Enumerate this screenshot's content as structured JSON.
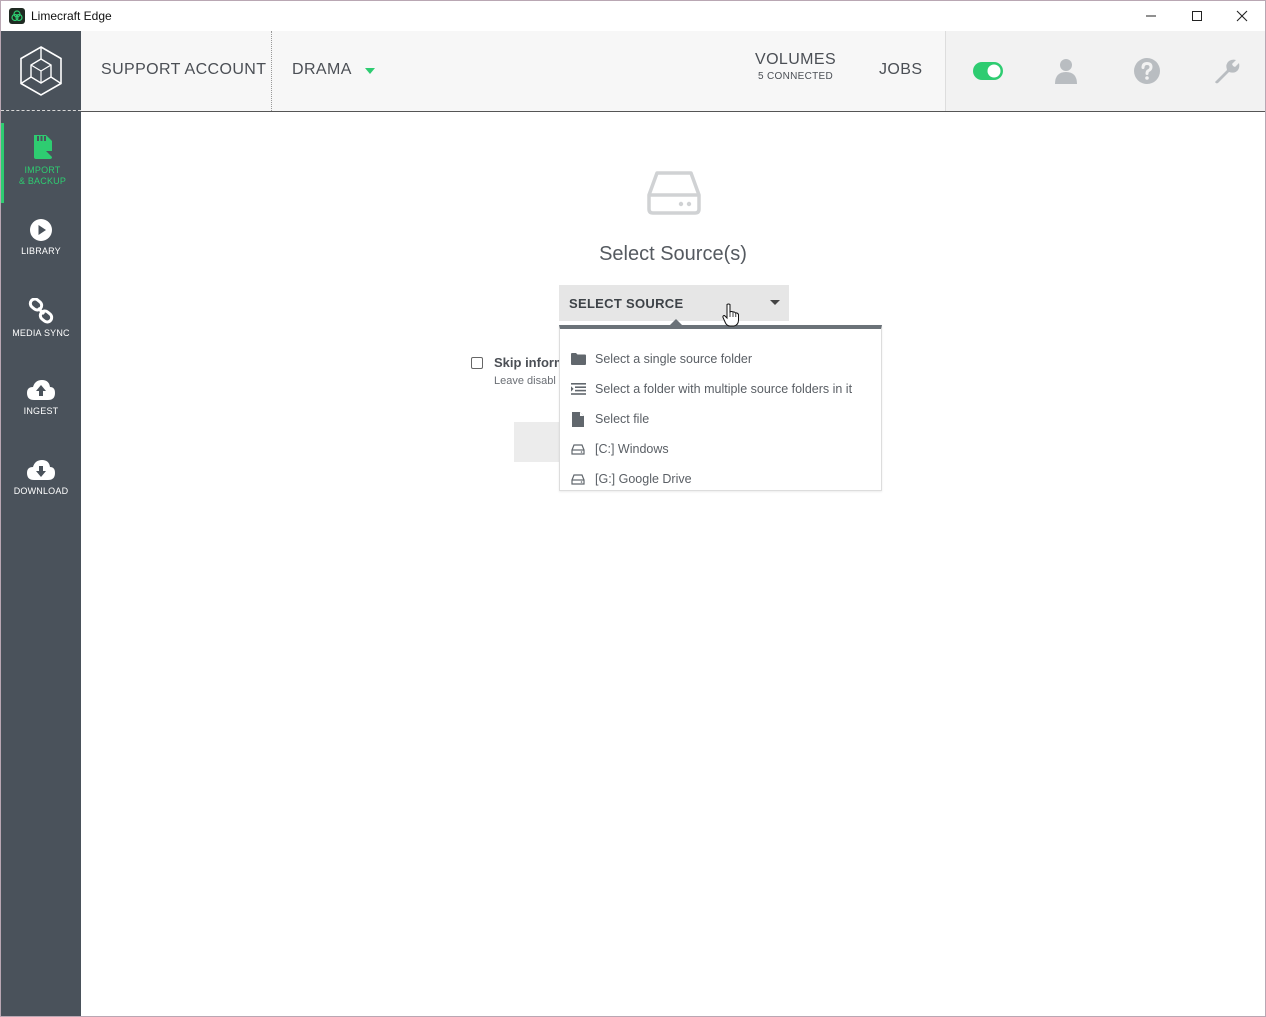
{
  "window": {
    "title": "Limecraft Edge",
    "controls": {
      "minimize": "—",
      "maximize": "☐",
      "close": "✕"
    }
  },
  "header": {
    "account": "SUPPORT ACCOUNT",
    "project": "DRAMA",
    "volumes_label": "VOLUMES",
    "volumes_status": "5 CONNECTED",
    "jobs_label": "JOBS",
    "accent_color": "#2ecc71"
  },
  "sidebar": {
    "items": [
      {
        "label_line1": "IMPORT",
        "label_line2": "& BACKUP",
        "icon": "sd-card-icon",
        "active": true
      },
      {
        "label_line1": "LIBRARY",
        "label_line2": "",
        "icon": "play-icon",
        "active": false
      },
      {
        "label_line1": "MEDIA SYNC",
        "label_line2": "",
        "icon": "link-icon",
        "active": false
      },
      {
        "label_line1": "INGEST",
        "label_line2": "",
        "icon": "cloud-upload-icon",
        "active": false
      },
      {
        "label_line1": "DOWNLOAD",
        "label_line2": "",
        "icon": "cloud-download-icon",
        "active": false
      }
    ]
  },
  "main": {
    "title": "Select Source(s)",
    "select_button": "SELECT SOURCE",
    "skip_label": "Skip inform",
    "skip_hint": "Leave disabl"
  },
  "dropdown": {
    "items": [
      {
        "label": "Select a single source folder",
        "icon": "folder-icon"
      },
      {
        "label": "Select a folder with multiple source folders in it",
        "icon": "list-indent-icon"
      },
      {
        "label": "Select file",
        "icon": "file-icon"
      },
      {
        "label": "[C:] Windows",
        "icon": "drive-icon"
      },
      {
        "label": "[G:] Google Drive",
        "icon": "drive-icon"
      }
    ]
  }
}
